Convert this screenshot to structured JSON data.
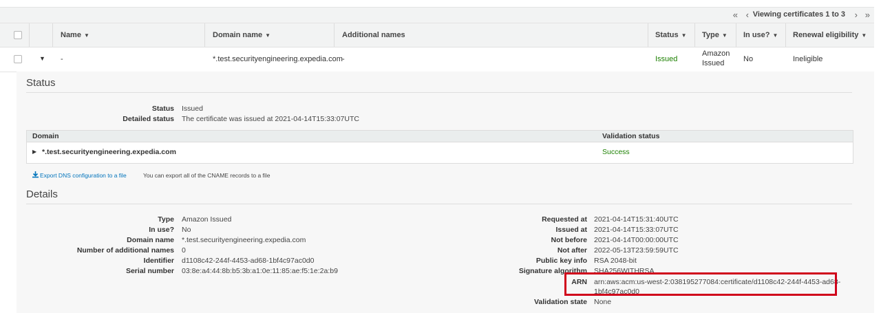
{
  "pager": {
    "first": "«",
    "prev": "‹",
    "text": "Viewing certificates 1 to 3",
    "next": "›",
    "last": "»"
  },
  "table": {
    "headers": {
      "name": "Name",
      "domain": "Domain name",
      "additional": "Additional names",
      "status": "Status",
      "type": "Type",
      "inuse": "In use?",
      "renewal": "Renewal eligibility"
    },
    "row": {
      "name": "-",
      "domain": "*.test.securityengineering.expedia.com",
      "additional": "-",
      "status": "Issued",
      "type_line1": "Amazon",
      "type_line2": "Issued",
      "inuse": "No",
      "renewal": "Ineligible"
    }
  },
  "status_section": {
    "title": "Status",
    "status_label": "Status",
    "status_value": "Issued",
    "detailed_label": "Detailed status",
    "detailed_value": "The certificate was issued at 2021-04-14T15:33:07UTC",
    "domain_header": "Domain",
    "validation_header": "Validation status",
    "domain_value": "*.test.securityengineering.expedia.com",
    "validation_value": "Success",
    "export_link": "Export DNS configuration to a file",
    "export_note": "You can export all of the CNAME records to a file"
  },
  "details": {
    "title": "Details",
    "left": [
      {
        "label": "Type",
        "value": "Amazon Issued"
      },
      {
        "label": "In use?",
        "value": "No"
      },
      {
        "label": "Domain name",
        "value": "*.test.securityengineering.expedia.com"
      },
      {
        "label": "Number of additional names",
        "value": "0"
      },
      {
        "label": "Identifier",
        "value": "d1108c42-244f-4453-ad68-1bf4c97ac0d0"
      },
      {
        "label": "Serial number",
        "value": "03:8e:a4:44:8b:b5:3b:a1:0e:11:85:ae:f5:1e:2a:b9"
      }
    ],
    "right": [
      {
        "label": "Requested at",
        "value": "2021-04-14T15:31:40UTC"
      },
      {
        "label": "Issued at",
        "value": "2021-04-14T15:33:07UTC"
      },
      {
        "label": "Not before",
        "value": "2021-04-14T00:00:00UTC"
      },
      {
        "label": "Not after",
        "value": "2022-05-13T23:59:59UTC"
      },
      {
        "label": "Public key info",
        "value": "RSA 2048-bit"
      },
      {
        "label": "Signature algorithm",
        "value": "SHA256WITHRSA"
      },
      {
        "label": "ARN",
        "value_line1": "arn:aws:acm:us-west-2:038195277084:certificate/d1108c42-244f-4453-ad68-",
        "value_line2": "1bf4c97ac0d0"
      },
      {
        "label": "Validation state",
        "value": "None"
      }
    ]
  },
  "colors": {
    "highlight": "#d0021b",
    "success": "#1d8102",
    "link": "#0073bb"
  }
}
